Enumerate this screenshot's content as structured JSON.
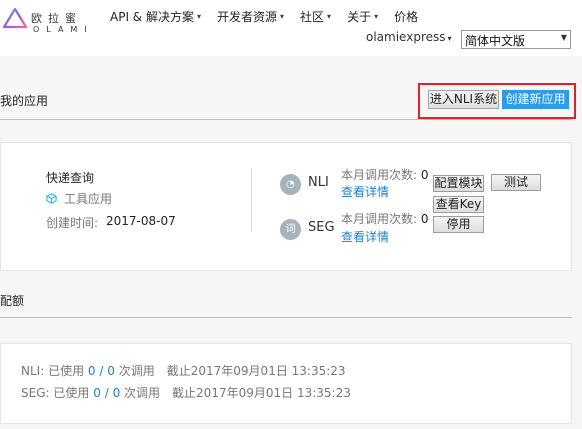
{
  "nav": {
    "logo_cn": "欧拉蜜",
    "logo_en": "OLAMI",
    "items": [
      {
        "label": "API & 解决方案"
      },
      {
        "label": "开发者资源"
      },
      {
        "label": "社区"
      },
      {
        "label": "关于"
      },
      {
        "label": "价格"
      }
    ],
    "user": "olamiexpress",
    "language": "简体中文版"
  },
  "my_apps": {
    "title": "我的应用",
    "enter_nlu_label": "进入NLI系统",
    "create_app_label": "创建新应用"
  },
  "app": {
    "name": "快递查询",
    "type": "工具应用",
    "created_label": "创建时间:",
    "created_value": "2017-08-07",
    "services": [
      {
        "icon_text": "◔",
        "name": "NLI",
        "count_label": "本月调用次数:",
        "count": "0",
        "link": "查看详情"
      },
      {
        "icon_text": "词",
        "name": "SEG",
        "count_label": "本月调用次数:",
        "count": "0",
        "link": "查看详情"
      }
    ],
    "buttons": {
      "config": "配置模块",
      "test": "测试",
      "view_key": "查看Key",
      "disable": "停用"
    }
  },
  "quota": {
    "title": "配额",
    "rows": [
      {
        "service": "NLI:",
        "used_label": "已使用",
        "used": "0",
        "sep": "/",
        "total": "0",
        "unit": "次调用",
        "expiry": "截止2017年09月01日 13:35:23"
      },
      {
        "service": "SEG:",
        "used_label": "已使用",
        "used": "0",
        "sep": "/",
        "total": "0",
        "unit": "次调用",
        "expiry": "截止2017年09月01日 13:35:23"
      }
    ]
  },
  "colors": {
    "accent": "#2d9be5",
    "link": "#1f80c8",
    "highlight_border": "#e0202b"
  }
}
